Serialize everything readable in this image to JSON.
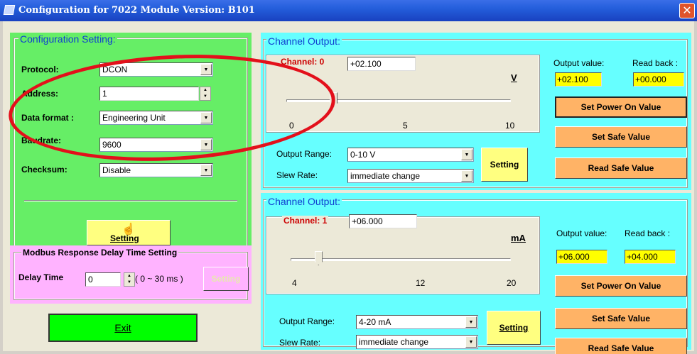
{
  "window": {
    "title": "Configuration for 7022 Module Version: B101",
    "close": "✕"
  },
  "config": {
    "title": "Configuration Setting:",
    "protocol": {
      "label": "Protocol:",
      "value": "DCON"
    },
    "address": {
      "label": "Address:",
      "value": "1"
    },
    "data_format": {
      "label": "Data format :",
      "value": "Engineering Unit"
    },
    "baudrate": {
      "label": "Baudrate:",
      "value": "9600"
    },
    "checksum": {
      "label": "Checksum:",
      "value": "Disable"
    },
    "setting_button": "Setting"
  },
  "modbus": {
    "title": "Modbus Response Delay Time Setting",
    "delay_label": "Delay Time",
    "delay_value": "0",
    "range_text": "( 0 ~ 30 ms )",
    "setting_button": "Setting"
  },
  "exit_button": "Exit",
  "channels": [
    {
      "group_title": "Channel Output:",
      "channel_label": "Channel: 0",
      "value": "+02.100",
      "unit": "V",
      "ticks": [
        "0",
        "5",
        "10"
      ],
      "slider_fraction": 0.21,
      "output_range_label": "Output Range:",
      "output_range_value": "0-10 V",
      "slew_rate_label": "Slew Rate:",
      "slew_rate_value": "immediate change",
      "setting_button": "Setting",
      "output_value_label": "Output value:",
      "read_back_label": "Read back :",
      "output_value": "+02.100",
      "read_back": "+00.000",
      "set_power_on": "Set Power On Value",
      "set_safe": "Set Safe Value",
      "read_safe": "Read Safe Value"
    },
    {
      "group_title": "Channel Output:",
      "channel_label": "Channel: 1",
      "value": "+06.000",
      "unit": "mA",
      "ticks": [
        "4",
        "12",
        "20"
      ],
      "slider_fraction": 0.125,
      "output_range_label": "Output Range:",
      "output_range_value": "4-20 mA",
      "slew_rate_label": "Slew Rate:",
      "slew_rate_value": "immediate change",
      "setting_button": "Setting",
      "output_value_label": "Output value:",
      "read_back_label": "Read back :",
      "output_value": "+06.000",
      "read_back": "+04.000",
      "set_power_on": "Set Power On Value",
      "set_safe": "Set Safe Value",
      "read_safe": "Read Safe Value"
    }
  ],
  "colors": {
    "config_bg": "#66ee66",
    "modbus_bg": "#ffb3ff",
    "channel_bg": "#66ffff",
    "button_yellow": "#ffff80",
    "button_orange": "#ffb366",
    "exit_green": "#00ff00",
    "annotation_red": "#e3101b"
  },
  "icons": {
    "close": "close-icon",
    "hand": "hand-cursor-icon"
  }
}
